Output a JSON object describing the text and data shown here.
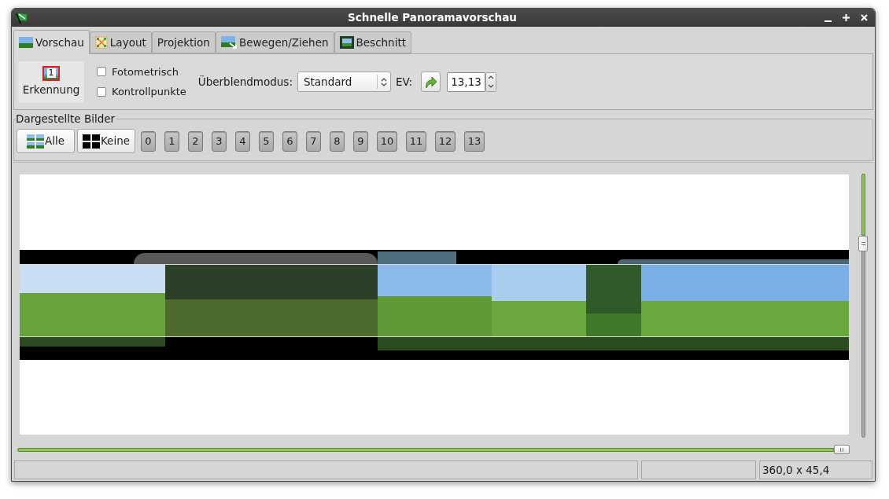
{
  "window": {
    "title": "Schnelle Panoramavorschau"
  },
  "tabs": [
    {
      "label": "Vorschau",
      "kind": "preview",
      "selected": true
    },
    {
      "label": "Layout",
      "kind": "layout",
      "selected": false
    },
    {
      "label": "Projektion",
      "kind": "plain",
      "selected": false
    },
    {
      "label": "Bewegen/Ziehen",
      "kind": "drag",
      "selected": false
    },
    {
      "label": "Beschnitt",
      "kind": "crop",
      "selected": false
    }
  ],
  "toolbar": {
    "identify_button": {
      "label": "Erkennung",
      "badge": "1"
    },
    "options": [
      {
        "label": "Fotometrisch",
        "checked": false
      },
      {
        "label": "Kontrollpunkte",
        "checked": false
      }
    ],
    "blend_mode": {
      "label": "Überblendmodus:",
      "value": "Standard"
    },
    "ev": {
      "label": "EV:",
      "value": "13,13"
    }
  },
  "displayed_images": {
    "title": "Dargestellte Bilder",
    "buttons": [
      {
        "kind": "all",
        "label": "Alle"
      },
      {
        "kind": "none",
        "label": "Keine"
      }
    ],
    "images": [
      {
        "label": "0",
        "on": true
      },
      {
        "label": "1",
        "on": true
      },
      {
        "label": "2",
        "on": true
      },
      {
        "label": "3",
        "on": true
      },
      {
        "label": "4",
        "on": true
      },
      {
        "label": "5",
        "on": true
      },
      {
        "label": "6",
        "on": true
      },
      {
        "label": "7",
        "on": true
      },
      {
        "label": "8",
        "on": true
      },
      {
        "label": "9",
        "on": true
      },
      {
        "label": "10",
        "on": true
      },
      {
        "label": "11",
        "on": true
      },
      {
        "label": "12",
        "on": true
      },
      {
        "label": "13",
        "on": true
      }
    ]
  },
  "preview": {
    "vertical_slider": {
      "level": 0.25
    },
    "horizontal_slider": {
      "level": 1.0
    }
  },
  "status_bar": {
    "size": "360,0 x 45,4"
  }
}
